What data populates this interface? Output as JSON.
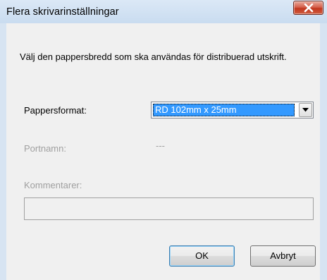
{
  "dialog": {
    "title": "Flera skrivarinställningar",
    "intro_text": "Välj den pappersbredd som ska användas för distribuerad utskrift.",
    "paper_format": {
      "label": "Pappersformat:",
      "selected_value": "RD 102mm x 25mm"
    },
    "port_name": {
      "label": "Portnamn:",
      "value": "---"
    },
    "comments": {
      "label": "Kommentarer:",
      "value": ""
    },
    "buttons": {
      "ok_label": "OK",
      "cancel_label": "Avbryt"
    }
  },
  "icons": {
    "close": "close-icon",
    "dropdown": "chevron-down-icon"
  },
  "colors": {
    "selection": "#3399ff",
    "close_button": "#c7402a",
    "disabled_text": "#a0a0a0"
  }
}
